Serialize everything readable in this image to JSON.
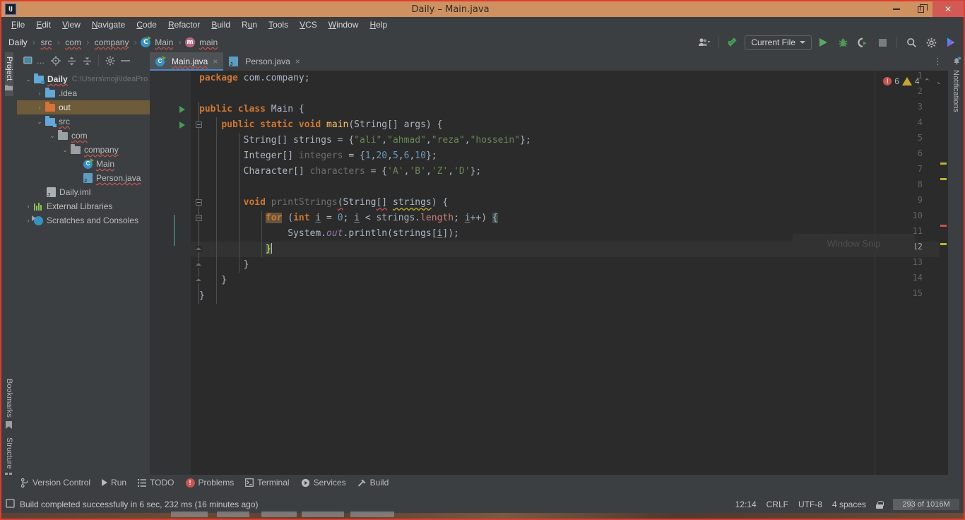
{
  "window": {
    "title": "Daily – Main.java",
    "app_icon": "intellij-idea-icon",
    "minimize_label": "Minimize",
    "maximize_label": "Restore",
    "close_label": "Close",
    "titlebar_color": "#cf9160",
    "close_color": "#d25a54"
  },
  "menubar": {
    "items": [
      {
        "label": "File",
        "mnemonic": "F"
      },
      {
        "label": "Edit",
        "mnemonic": "E"
      },
      {
        "label": "View",
        "mnemonic": "V"
      },
      {
        "label": "Navigate",
        "mnemonic": "N"
      },
      {
        "label": "Code",
        "mnemonic": "C"
      },
      {
        "label": "Refactor",
        "mnemonic": "R"
      },
      {
        "label": "Build",
        "mnemonic": "B"
      },
      {
        "label": "Run",
        "mnemonic": "u"
      },
      {
        "label": "Tools",
        "mnemonic": "T"
      },
      {
        "label": "VCS",
        "mnemonic": "V"
      },
      {
        "label": "Window",
        "mnemonic": "W"
      },
      {
        "label": "Help",
        "mnemonic": "H"
      }
    ]
  },
  "navbar": {
    "breadcrumbs": [
      {
        "label": "Daily",
        "icon": ""
      },
      {
        "label": "src",
        "icon": ""
      },
      {
        "label": "com",
        "icon": ""
      },
      {
        "label": "company",
        "icon": ""
      },
      {
        "label": "Main",
        "icon": "java-class-icon",
        "icon_char": "C"
      },
      {
        "label": "main",
        "icon": "java-method-icon",
        "icon_char": "m"
      }
    ],
    "separator": "›",
    "run_config": "Current File",
    "actions": [
      "user-avatar-icon",
      "update-project-icon",
      "run-icon",
      "debug-icon",
      "run-with-coverage-icon",
      "stop-icon",
      "search-everywhere-icon",
      "settings-gear-icon",
      "ide-assistant-icon"
    ]
  },
  "left_strip": {
    "top": [
      {
        "label": "Project",
        "icon": "project-folder-icon",
        "active": true
      }
    ],
    "bottom": [
      {
        "label": "Bookmarks",
        "icon": "bookmark-icon",
        "active": false
      },
      {
        "label": "Structure",
        "icon": "structure-icon",
        "active": false
      }
    ]
  },
  "right_strip": {
    "items": [
      {
        "label": "Notifications",
        "icon": "bell-icon"
      }
    ]
  },
  "project_panel": {
    "toolbar": [
      "project-view-selector",
      "scroll-from-source-icon",
      "expand-all-icon",
      "collapse-all-icon",
      "panel-settings-icon",
      "hide-panel-icon"
    ],
    "tree": [
      {
        "label": "Daily",
        "suffix": "C:\\Users\\moji\\IdeaPro",
        "depth": 0,
        "arrow": "⌄",
        "icon": "module-folder-icon",
        "selected": false,
        "bold": true
      },
      {
        "label": ".idea",
        "suffix": "",
        "depth": 1,
        "arrow": "›",
        "icon": "folder-icon",
        "selected": false,
        "bold": false
      },
      {
        "label": "out",
        "suffix": "",
        "depth": 1,
        "arrow": "›",
        "icon": "excluded-folder-icon",
        "selected": true,
        "bold": false
      },
      {
        "label": "src",
        "suffix": "",
        "depth": 1,
        "arrow": "⌄",
        "icon": "source-folder-icon",
        "selected": false,
        "bold": false
      },
      {
        "label": "com",
        "suffix": "",
        "depth": 2,
        "arrow": "⌄",
        "icon": "package-icon",
        "selected": false,
        "bold": false
      },
      {
        "label": "company",
        "suffix": "",
        "depth": 3,
        "arrow": "⌄",
        "icon": "package-icon",
        "selected": false,
        "bold": false
      },
      {
        "label": "Main",
        "suffix": "",
        "depth": 4,
        "arrow": "",
        "icon": "java-class-icon",
        "selected": false,
        "bold": false
      },
      {
        "label": "Person.java",
        "suffix": "",
        "depth": 4,
        "arrow": "",
        "icon": "java-file-icon",
        "selected": false,
        "bold": false
      },
      {
        "label": "Daily.iml",
        "suffix": "",
        "depth": 2,
        "arrow": "",
        "icon": "iml-file-icon",
        "selected": false,
        "bold": false
      },
      {
        "label": "External Libraries",
        "suffix": "",
        "depth": 0,
        "arrow": "›",
        "icon": "libraries-icon",
        "selected": false,
        "bold": false
      },
      {
        "label": "Scratches and Consoles",
        "suffix": "",
        "depth": 0,
        "arrow": "›",
        "icon": "scratches-icon",
        "selected": false,
        "bold": false
      }
    ]
  },
  "editor": {
    "tabs": [
      {
        "label": "Main.java",
        "icon": "java-class-icon",
        "active": true,
        "close": "×"
      },
      {
        "label": "Person.java",
        "icon": "java-file-icon",
        "active": false,
        "close": "×"
      }
    ],
    "tab_overflow": "⋮",
    "inspections": {
      "errors": "6",
      "warnings": "4",
      "up": "⌃",
      "down": "⌄"
    },
    "watermark": "Window Snip",
    "current_line": 12,
    "lines": [
      {
        "n": "1",
        "text": "package com.company;"
      },
      {
        "n": "2",
        "text": ""
      },
      {
        "n": "3",
        "text": "public class Main {"
      },
      {
        "n": "4",
        "text": "    public static void main(String[] args) {"
      },
      {
        "n": "5",
        "text": "        String[] strings = {\"ali\",\"ahmad\",\"reza\",\"hossein\"};"
      },
      {
        "n": "6",
        "text": "        Integer[] integers = {1,20,5,6,10};"
      },
      {
        "n": "7",
        "text": "        Character[] characters = {'A','B','Z','D'};"
      },
      {
        "n": "8",
        "text": ""
      },
      {
        "n": "9",
        "text": "        void printStrings(String[] strings) {"
      },
      {
        "n": "10",
        "text": "            for (int i = 0; i < strings.length; i++) {"
      },
      {
        "n": "11",
        "text": "                System.out.println(strings[i]);"
      },
      {
        "n": "12",
        "text": "            }"
      },
      {
        "n": "13",
        "text": "        }"
      },
      {
        "n": "14",
        "text": "    }"
      },
      {
        "n": "15",
        "text": "}"
      }
    ]
  },
  "bottom_bar": {
    "items": [
      {
        "label": "Version Control",
        "icon": "branch-icon"
      },
      {
        "label": "Run",
        "icon": "run-icon"
      },
      {
        "label": "TODO",
        "icon": "todo-list-icon"
      },
      {
        "label": "Problems",
        "icon": "problems-icon"
      },
      {
        "label": "Terminal",
        "icon": "terminal-icon"
      },
      {
        "label": "Services",
        "icon": "services-icon"
      },
      {
        "label": "Build",
        "icon": "build-hammer-icon"
      }
    ]
  },
  "status_bar": {
    "message": "Build completed successfully in 6 sec, 232 ms (16 minutes ago)",
    "message_icon": "event-log-icon",
    "caret_position": "12:14",
    "line_separator": "CRLF",
    "encoding": "UTF-8",
    "indent": "4 spaces",
    "lock_icon": "read-write-lock-icon",
    "memory": "293 of 1016M"
  }
}
